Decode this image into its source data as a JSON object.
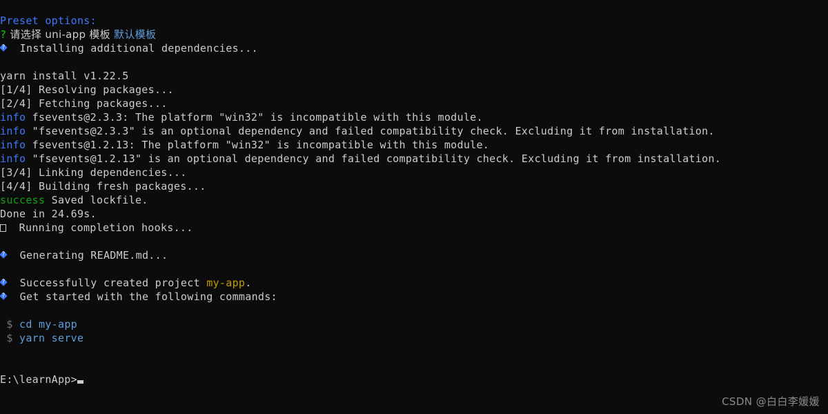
{
  "terminal": {
    "background_color": "#0c0c0c",
    "foreground_color": "#cccccc",
    "prompt": "E:\\learnApp>",
    "cursor": "block"
  },
  "palette": {
    "white": "#cccccc",
    "blue": "#3b78ff",
    "bright_blue": "#5c9ddb",
    "green": "#16c60c",
    "dark_green": "#13a10e",
    "yellow": "#c19c00",
    "dim": "#767676"
  },
  "lines": {
    "preset_options": "Preset options:",
    "question_mark": "?",
    "question_text": " 请选择 uni-app 模板 ",
    "question_answer": "默认模板",
    "installing": "  Installing additional dependencies...",
    "yarn_version": "yarn install v1.22.5",
    "step1_tag": "[1/4]",
    "step1_text": " Resolving packages...",
    "step2_tag": "[2/4]",
    "step2_text": " Fetching packages...",
    "info_label": "info",
    "info1_text": " fsevents@2.3.3: The platform \"win32\" is incompatible with this module.",
    "info2_text": " \"fsevents@2.3.3\" is an optional dependency and failed compatibility check. Excluding it from installation.",
    "info3_text": " fsevents@1.2.13: The platform \"win32\" is incompatible with this module.",
    "info4_text": " \"fsevents@1.2.13\" is an optional dependency and failed compatibility check. Excluding it from installation.",
    "step3_tag": "[3/4]",
    "step3_text": " Linking dependencies...",
    "step4_tag": "[4/4]",
    "step4_text": " Building fresh packages...",
    "success_label": "success",
    "success_text": " Saved lockfile.",
    "done_text": "Done in 24.69s.",
    "hooks_text": "  Running completion hooks...",
    "generating_readme": "  Generating README.md...",
    "created_prefix": "  Successfully created project ",
    "created_project": "my-app",
    "created_suffix": ".",
    "get_started": "  Get started with the following commands:",
    "dollar": " $",
    "cmd_cd": " cd my-app",
    "cmd_serve": " yarn serve"
  },
  "watermark": {
    "text": "CSDN @白白李媛媛"
  }
}
